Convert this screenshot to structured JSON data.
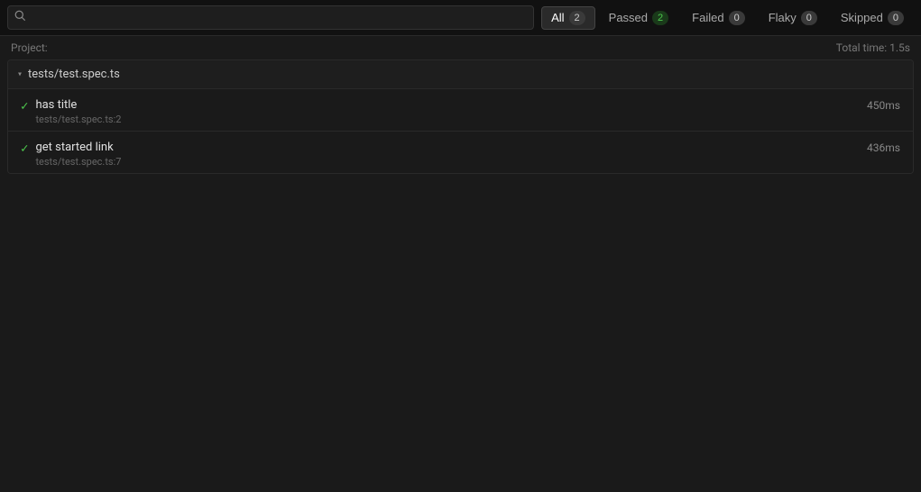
{
  "topbar": {
    "search_placeholder": ""
  },
  "filters": [
    {
      "id": "all",
      "label": "All",
      "count": "2",
      "active": true,
      "type": "all"
    },
    {
      "id": "passed",
      "label": "Passed",
      "count": "2",
      "active": false,
      "type": "passed"
    },
    {
      "id": "failed",
      "label": "Failed",
      "count": "0",
      "active": false,
      "type": "failed"
    },
    {
      "id": "flaky",
      "label": "Flaky",
      "count": "0",
      "active": false,
      "type": "flaky"
    },
    {
      "id": "skipped",
      "label": "Skipped",
      "count": "0",
      "active": false,
      "type": "skipped"
    }
  ],
  "project": {
    "label": "Project:",
    "total_time_label": "Total time: 1.5s"
  },
  "spec_group": {
    "name": "tests/test.spec.ts",
    "expanded": true
  },
  "tests": [
    {
      "name": "has title",
      "path": "tests/test.spec.ts:2",
      "duration": "450ms",
      "status": "passed"
    },
    {
      "name": "get started link",
      "path": "tests/test.spec.ts:7",
      "duration": "436ms",
      "status": "passed"
    }
  ],
  "icons": {
    "search": "🔍",
    "chevron_down": "▾",
    "check": "✓"
  }
}
